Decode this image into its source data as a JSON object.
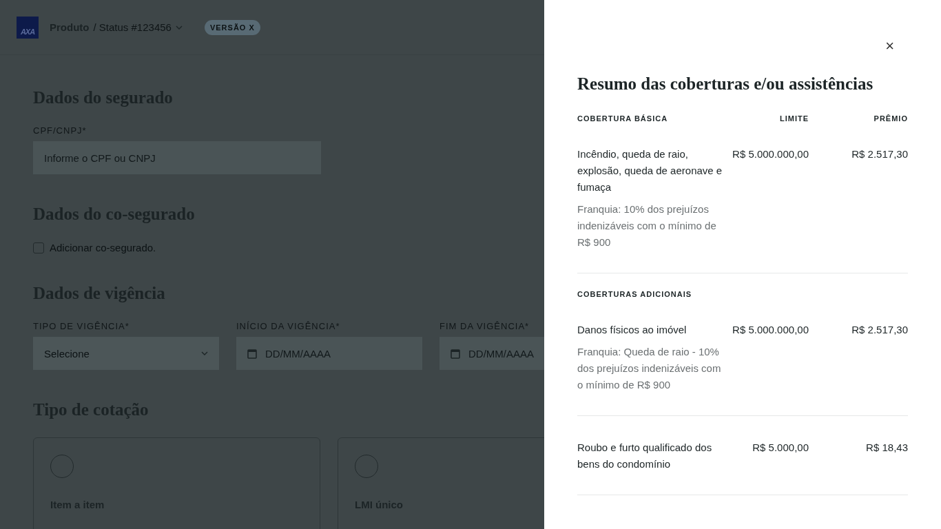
{
  "header": {
    "logo": "AXA",
    "product": "Produto",
    "status": "/ Status #123456",
    "version_badge": "VERSÃO X"
  },
  "sections": [
    {
      "kind": "field",
      "title": "Dados do segurado",
      "fields": [
        {
          "kind": "text",
          "label": "CPF/CNPJ*",
          "placeholder": "Informe o CPF ou CNPJ"
        }
      ]
    },
    {
      "kind": "checkbox",
      "title": "Dados do co-segurado",
      "checkbox": {
        "label": "Adicionar co-segurado.",
        "checked": false
      }
    },
    {
      "kind": "field",
      "title": "Dados de vigência",
      "fields": [
        {
          "kind": "select",
          "label": "TIPO DE VIGÊNCIA*",
          "placeholder": "Selecione"
        },
        {
          "kind": "date",
          "label": "INÍCIO DA VIGÊNCIA*",
          "placeholder": "DD/MM/AAAA"
        },
        {
          "kind": "date",
          "label": "FIM DA VIGÊNCIA*",
          "placeholder": "DD/MM/AAAA"
        }
      ]
    },
    {
      "kind": "cards",
      "title": "Tipo de cotação",
      "cards": [
        {
          "label": "Item a item",
          "selected": false
        },
        {
          "label": "LMI único",
          "selected": false
        }
      ]
    }
  ],
  "drawer": {
    "close": "×",
    "title": "Resumo das coberturas e/ou assistências",
    "groups": [
      {
        "title": "COBERTURA BÁSICA",
        "columns": [
          "LIMITE",
          "PRÊMIO"
        ],
        "items": [
          {
            "name": "Incêndio, queda de raio, explosão, queda de aeronave e fumaça",
            "note": "Franquia: 10% dos prejuízos indenizáveis com o mínimo de R$ 900",
            "limit": "R$ 5.000.000,00",
            "premium": "R$ 2.517,30"
          }
        ]
      },
      {
        "title": "COBERTURAS ADICIONAIS",
        "items": [
          {
            "name": "Danos físicos ao imóvel",
            "note": "Franquia: Queda de raio - 10% dos prejuízos indenizáveis com o mínimo de R$ 900",
            "limit": "R$ 5.000.000,00",
            "premium": "R$ 2.517,30"
          },
          {
            "name": "Roubo e furto qualificado dos bens do condomínio",
            "limit": "R$ 5.000,00",
            "premium": "R$ 18,43"
          }
        ]
      }
    ]
  }
}
